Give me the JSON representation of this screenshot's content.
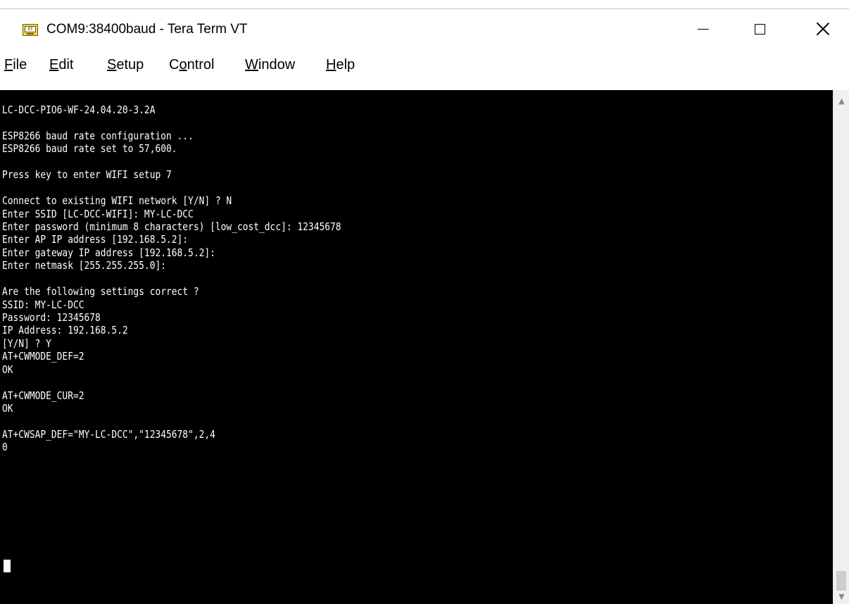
{
  "window": {
    "title": "COM9:38400baud - Tera Term VT",
    "app_icon_text": "VT"
  },
  "menu": {
    "file": {
      "mnemonic": "F",
      "rest": "ile"
    },
    "edit": {
      "mnemonic": "E",
      "rest": "dit"
    },
    "setup": {
      "mnemonic": "S",
      "rest": "etup"
    },
    "control": {
      "pre": "C",
      "mnemonic": "o",
      "rest": "ntrol"
    },
    "window": {
      "mnemonic": "W",
      "rest": "indow"
    },
    "help": {
      "mnemonic": "H",
      "rest": "elp"
    }
  },
  "terminal": {
    "lines": [
      "LC-DCC-PIO6-WF-24.04.20-3.2A",
      "",
      "ESP8266 baud rate configuration ...",
      "ESP8266 baud rate set to 57,600.",
      "",
      "Press key to enter WIFI setup 7",
      "",
      "Connect to existing WIFI network [Y/N] ? N",
      "Enter SSID [LC-DCC-WIFI]: MY-LC-DCC",
      "Enter password (minimum 8 characters) [low_cost_dcc]: 12345678",
      "Enter AP IP address [192.168.5.2]:",
      "Enter gateway IP address [192.168.5.2]:",
      "Enter netmask [255.255.255.0]:",
      "",
      "Are the following settings correct ?",
      "SSID: MY-LC-DCC",
      "Password: 12345678",
      "IP Address: 192.168.5.2",
      "[Y/N] ? Y",
      "AT+CWMODE_DEF=2",
      "OK",
      "",
      "AT+CWMODE_CUR=2",
      "OK",
      "",
      "AT+CWSAP_DEF=\"MY-LC-DCC\",\"12345678\",2,4",
      "0"
    ]
  }
}
